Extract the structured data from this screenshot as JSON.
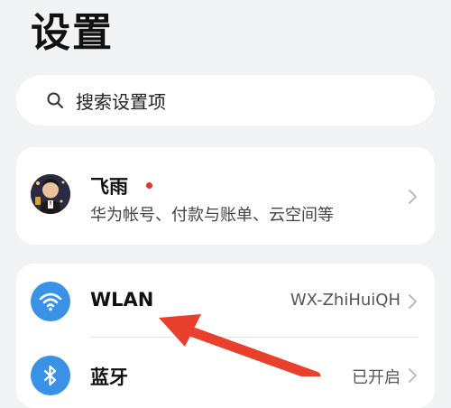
{
  "header": {
    "title": "设置"
  },
  "search": {
    "icon": "search-icon",
    "placeholder": "搜索设置项"
  },
  "account": {
    "name": "飞雨",
    "subtitle": "华为帐号、付款与账单、云空间等",
    "has_notification_dot": true,
    "notification_dot_color": "#e0352b"
  },
  "settings_items": [
    {
      "icon": "wifi-icon",
      "label": "WLAN",
      "value": "WX-ZhiHuiQH",
      "icon_color": "#3a92e6"
    },
    {
      "icon": "bluetooth-icon",
      "label": "蓝牙",
      "value": "已开启",
      "icon_color": "#3a92e6"
    }
  ],
  "annotation": {
    "type": "red-arrow",
    "color": "#e8402c",
    "points_to": "WLAN"
  }
}
